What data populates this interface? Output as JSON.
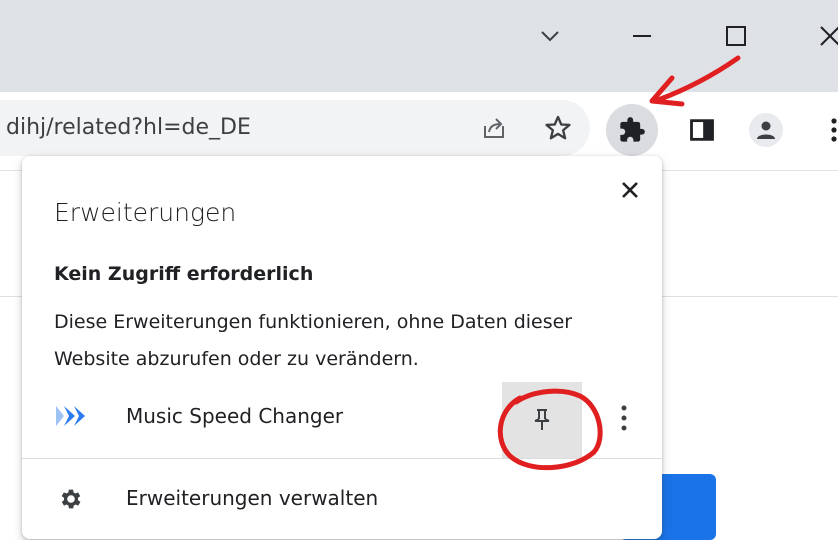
{
  "omnibox": {
    "url_text": "dihj/related?hl=de_DE"
  },
  "popup": {
    "title": "Erweiterungen",
    "section_heading": "Kein Zugriff erforderlich",
    "section_description": "Diese Erweiterungen funktionieren, ohne Daten dieser Website abzurufen oder zu verändern.",
    "extensions": [
      {
        "name": "Music Speed Changer",
        "icon": "music-speed-changer-logo",
        "pinned": false
      }
    ],
    "manage_label": "Erweiterungen verwalten"
  },
  "icons": {
    "tab_search": "chevron-down-icon",
    "minimize": "minimize-icon",
    "maximize": "maximize-icon",
    "close_window": "close-icon",
    "share": "share-icon",
    "bookmark": "star-icon",
    "extensions": "puzzle-icon",
    "side_panel": "side-panel-icon",
    "profile": "person-icon",
    "menu": "three-dots-vertical-icon",
    "pin": "pin-icon",
    "manage": "gear-icon"
  },
  "colors": {
    "titlebar": "#dee1e6",
    "omnibox": "#f1f3f4",
    "accent_blue": "#1a73e8",
    "annotation_red": "#e02020",
    "extension_logo": "#2b7bf0"
  }
}
